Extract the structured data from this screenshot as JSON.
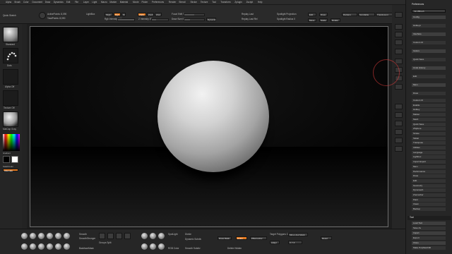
{
  "app": {
    "accent": "#e3781f"
  },
  "menu": [
    "Alpha",
    "Brush",
    "Color",
    "Document",
    "Draw",
    "Dynamics",
    "Edit",
    "File",
    "Layer",
    "Light",
    "Macro",
    "Marker",
    "Material",
    "Movie",
    "Picker",
    "Preferences",
    "Render",
    "Stencil",
    "Stroke",
    "Texture",
    "Tool",
    "Transform",
    "Zplugin",
    "Zscript",
    "Help"
  ],
  "toolbar": {
    "quick_sketch": "Quick Sketch",
    "active_points": "ActivePoints: 8,090",
    "total_points": "TotalPoints: 8,090",
    "lightbox": "LightBox",
    "mrgb": "Mrgb",
    "rgb": "Rgb",
    "m": "M",
    "zadd": "Zadd",
    "zsub": "Zsub",
    "zcut": "Zcut",
    "focal_shift": "Focal Shift 0",
    "draw_size": "Draw Size 64",
    "rgb_intensity": "Rgb Intensity 100",
    "z_intensity": "Z Intensity 25",
    "dynamic": "Dynamic",
    "replay_last": "Replay Last",
    "replay_last_rel": "Replay Last Rel",
    "spotlight_proj": "Spotlight Projection",
    "spotlight_radius": "Spotlight Radius 0",
    "edit": "Edit",
    "draw": "Draw",
    "move": "Move",
    "scale": "Scale",
    "rotate": "Rotate",
    "dividers": "Dividers",
    "scrollable": "Scrollable",
    "translucent": "Translucent"
  },
  "left_shelf": {
    "standard": "Standard",
    "dots": "Dots",
    "alpha_off": "Alpha Off",
    "texture_off": "Texture Off",
    "matcap": "MatCap Gray",
    "gradient": "Gradient",
    "switch_color": "SwitchColor",
    "alternate": "Alternate"
  },
  "tray": {
    "title": "Preferences",
    "search": "Init ZBrush",
    "top_items": [
      "Config",
      "Hotkeys",
      "Interface",
      "Custom UI",
      "Icolors",
      "Quick Save",
      "Undo History",
      "Edit",
      "Mem",
      "Draw"
    ],
    "sub_items": [
      "Custom UI",
      "Enable",
      "Hotkey",
      "Marker",
      "Mesh",
      "Quick Save",
      "ZSphere",
      "Stroke",
      "Tablet",
      "Transpose",
      "Utilities",
      "Language",
      "Lightbox",
      "Import Export",
      "Mem",
      "Performance",
      "Draw",
      "Edit",
      "Geometry",
      "Dynamesh",
      "Zremesher",
      "Paint",
      "Clean",
      "Backup"
    ],
    "tool": "Tool",
    "tool_items": [
      "Load Tool",
      "Save As",
      "Import",
      "Export",
      "Clone",
      "Make PolyMesh3D"
    ]
  },
  "bottom": {
    "smooth": "Smooth",
    "smooth_stronger": "SmoothStronger",
    "back_face_mask": "BackfaceMask",
    "groups_split": "Groups Split",
    "rgb_color": "RGB Color",
    "draw_mask": "Draw Mask",
    "spotlight": "SpotLight",
    "divide": "Divide",
    "dynamic_subdiv": "Dynamic Subdiv",
    "smooth_subdiv": "Smooth Subdiv",
    "delete_hidden": "Delete Hidden",
    "zremesher": "ZRemesher",
    "target_poly": "Target Polygons Count 5",
    "adapt": "Adapt",
    "mirror_weld": "Mirror And Weld",
    "sym": "X Y Z",
    "reset": "Reset",
    "union": "Union"
  }
}
